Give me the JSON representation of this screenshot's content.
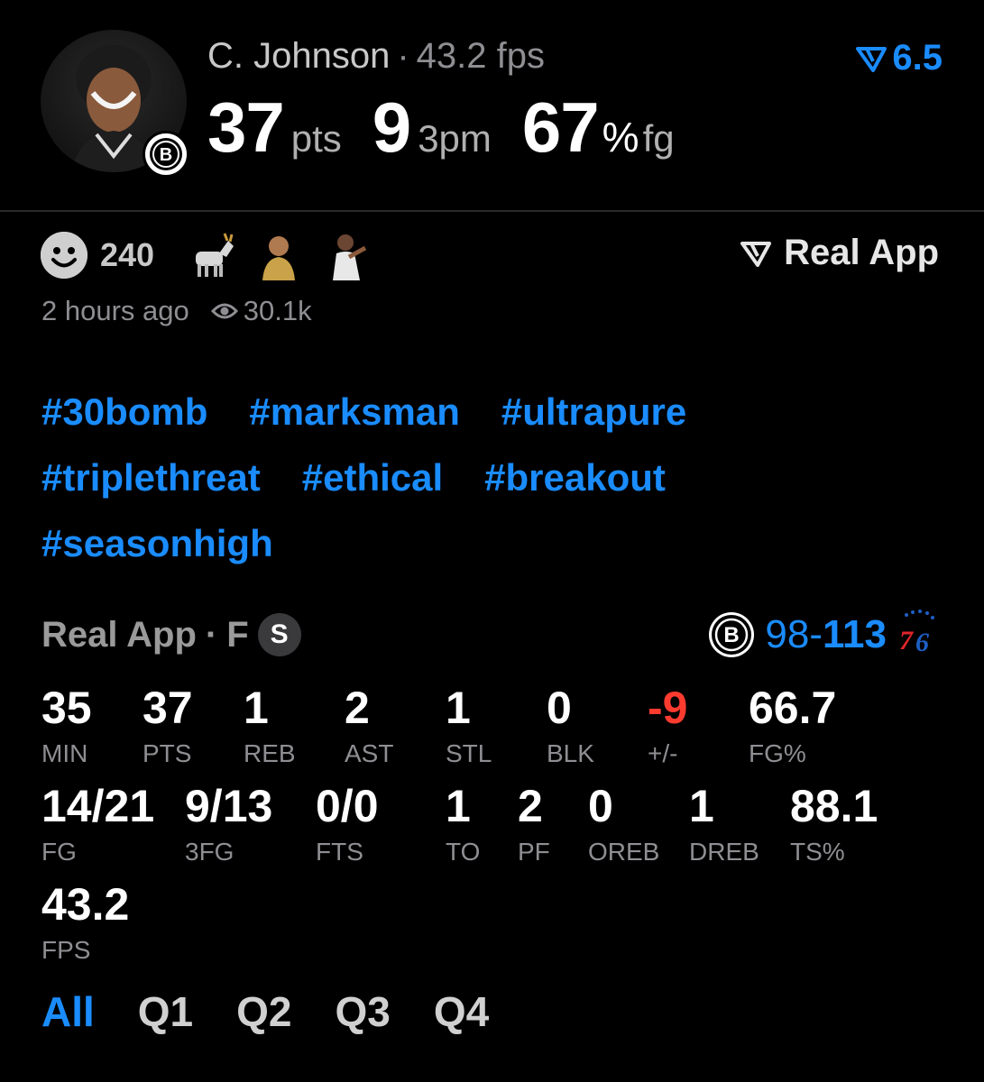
{
  "player": {
    "name": "C. Johnson",
    "separator": "·",
    "fps_text": "43.2 fps",
    "points": "37",
    "points_unit": "pts",
    "threes": "9",
    "threes_unit": "3pm",
    "fg_pct": "67",
    "fg_pct_symbol": "%",
    "fg_unit": "fg"
  },
  "rating": {
    "value": "6.5",
    "icon": "real-v-logo",
    "color": "#1a8cff"
  },
  "reactions": {
    "count": "240",
    "items": [
      "smile-icon",
      "goat-emoji",
      "player-sticker-1",
      "player-sticker-2"
    ]
  },
  "brand": {
    "label": "Real App",
    "icon": "real-v-logo"
  },
  "meta": {
    "time": "2 hours ago",
    "views": "30.1k"
  },
  "hashtags": [
    [
      "#30bomb",
      "#marksman",
      "#ultrapure"
    ],
    [
      "#triplethreat",
      "#ethical",
      "#breakout"
    ],
    [
      "#seasonhigh"
    ]
  ],
  "game": {
    "source": "Real App",
    "separator": "·",
    "status": "F",
    "badge": "S",
    "home_score": "98",
    "dash": "-",
    "away_score": "113",
    "home_team_icon": "nets-logo",
    "away_team_icon": "76ers-logo"
  },
  "stats_row1": [
    {
      "v": "35",
      "l": "MIN"
    },
    {
      "v": "37",
      "l": "PTS"
    },
    {
      "v": "1",
      "l": "REB"
    },
    {
      "v": "2",
      "l": "AST"
    },
    {
      "v": "1",
      "l": "STL"
    },
    {
      "v": "0",
      "l": "BLK"
    },
    {
      "v": "-9",
      "l": "+/-"
    },
    {
      "v": "66.7",
      "l": "FG%"
    }
  ],
  "stats_row2": [
    {
      "v": "14/21",
      "l": "FG"
    },
    {
      "v": "9/13",
      "l": "3FG"
    },
    {
      "v": "0/0",
      "l": "FTS"
    },
    {
      "v": "1",
      "l": "TO"
    },
    {
      "v": "2",
      "l": "PF"
    },
    {
      "v": "0",
      "l": "OREB"
    },
    {
      "v": "1",
      "l": "DREB"
    },
    {
      "v": "88.1",
      "l": "TS%"
    }
  ],
  "stats_row3": [
    {
      "v": "43.2",
      "l": "FPS"
    }
  ],
  "quarters": {
    "items": [
      "All",
      "Q1",
      "Q2",
      "Q3",
      "Q4"
    ],
    "active": "All"
  },
  "colors": {
    "accent": "#1a8cff",
    "negative": "#ff3b30",
    "muted": "#8e8e93"
  }
}
